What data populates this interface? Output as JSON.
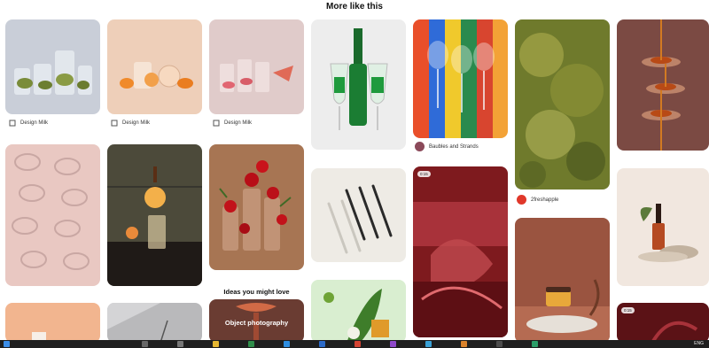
{
  "page": {
    "title": "More like this"
  },
  "pins": [
    {
      "id": "glass-cucumber",
      "source": "Design Milk"
    },
    {
      "id": "glass-orange",
      "source": "Design Milk"
    },
    {
      "id": "glass-pink",
      "source": "Design Milk"
    },
    {
      "id": "bottle-green"
    },
    {
      "id": "colored-glasses",
      "source": "Baubles and Strands"
    },
    {
      "id": "green-bokeh"
    },
    {
      "id": "honey-spoons"
    },
    {
      "id": "pink-glasses-grid"
    },
    {
      "id": "orange-dark"
    },
    {
      "id": "red-roses"
    },
    {
      "id": "forks-shadow"
    },
    {
      "id": "red-glass-abstract",
      "badge": "0:15"
    },
    {
      "id": "serum-bottle",
      "source": "2freshapple"
    },
    {
      "id": "cream-jar"
    },
    {
      "id": "peach-tile"
    },
    {
      "id": "gray-lamp"
    },
    {
      "id": "object-photography",
      "label": "Object photography"
    },
    {
      "id": "green-leaf"
    },
    {
      "id": "dark-red-bottom",
      "badge": "0:15"
    }
  ],
  "ideas": {
    "heading": "Ideas you might love"
  },
  "taskbar": {
    "language": "ENG"
  },
  "colors": {
    "accent": "#e60023"
  }
}
